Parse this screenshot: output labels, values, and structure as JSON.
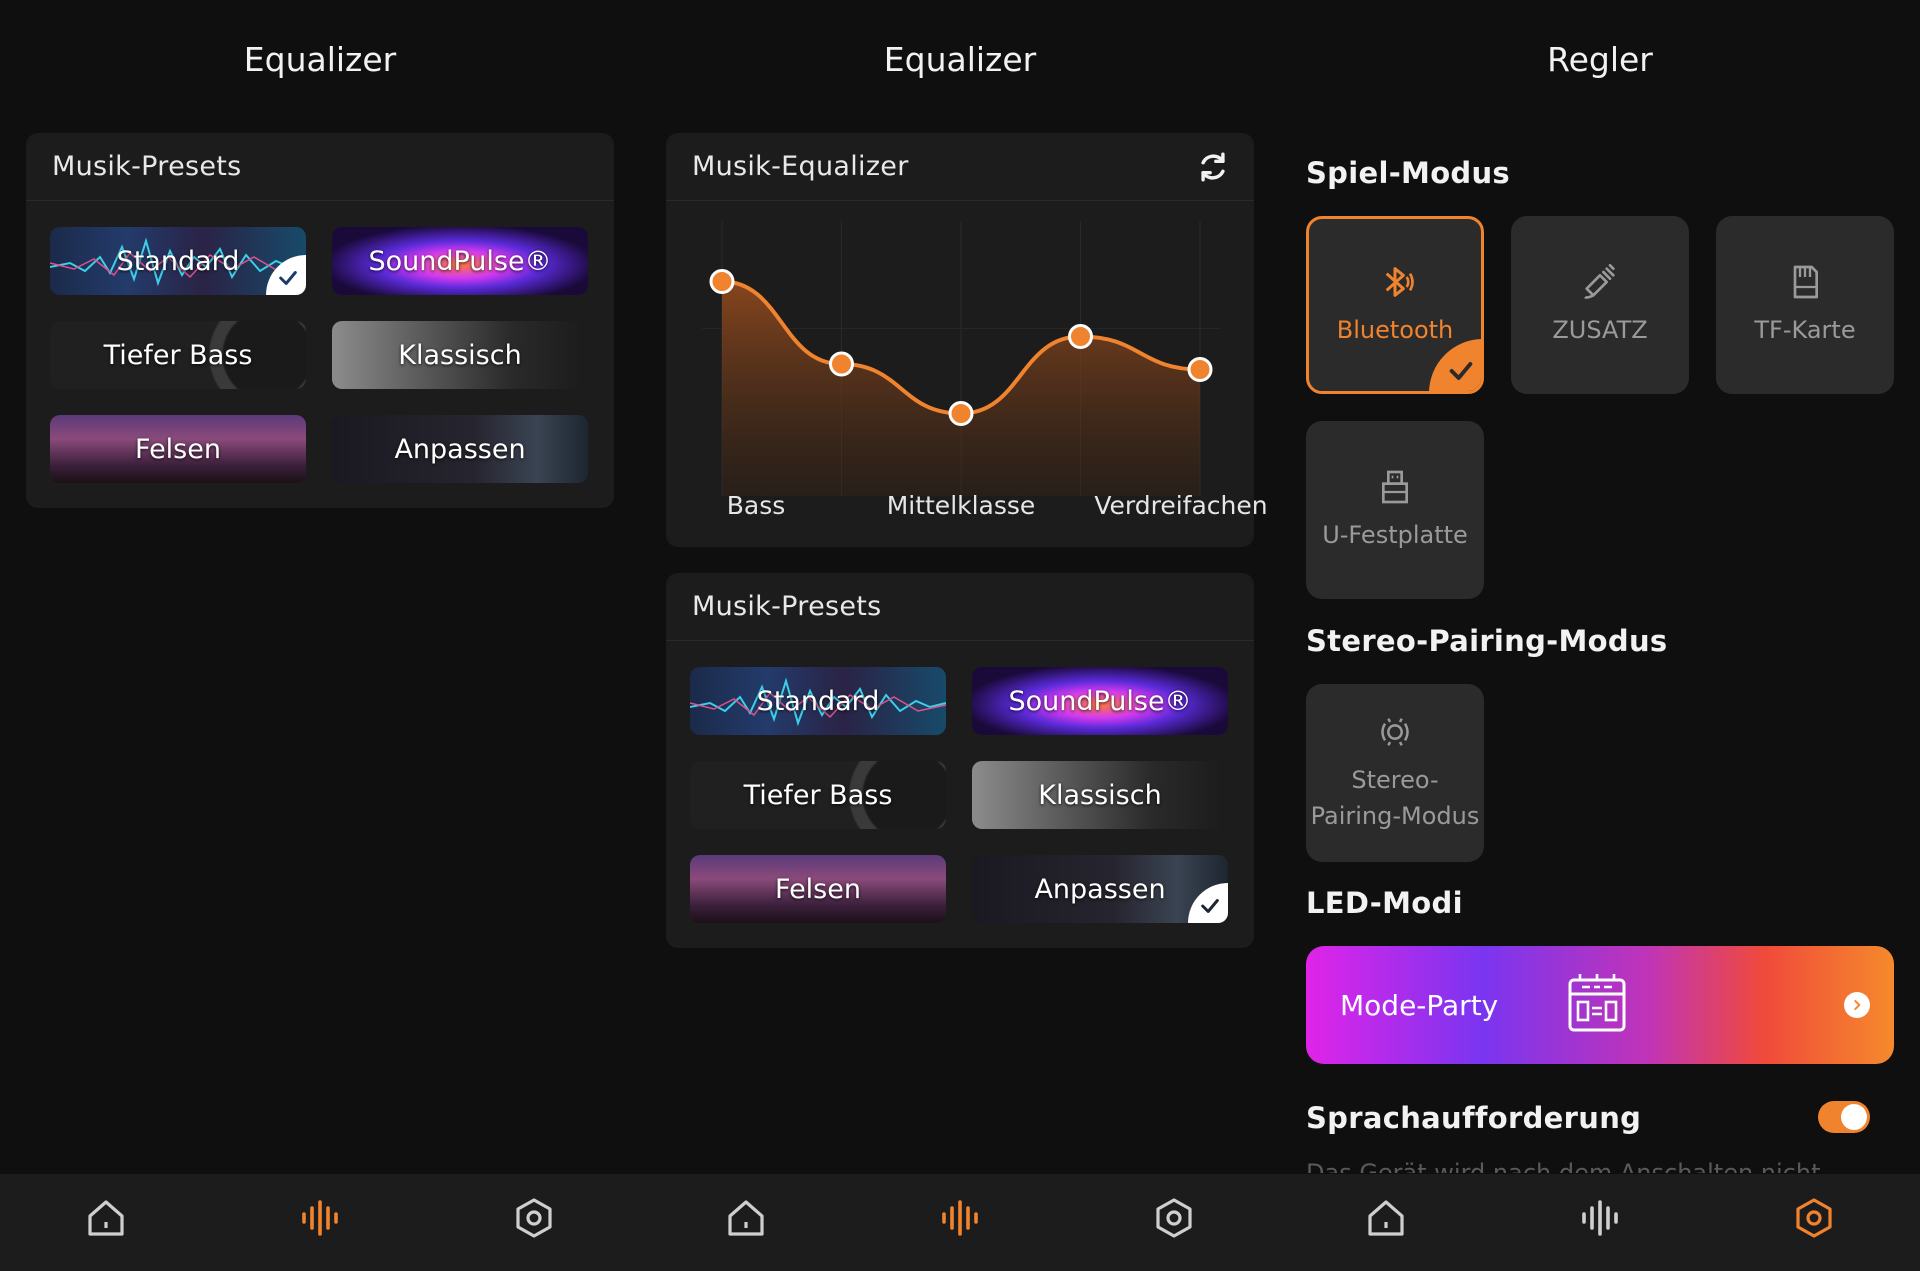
{
  "colors": {
    "accent": "#f0832e",
    "background": "#0f0f0f",
    "card": "#1c1c1c",
    "tile": "#2b2b2b",
    "inactive_text": "#9a9a9a"
  },
  "screen1": {
    "title": "Equalizer",
    "presets_card": {
      "header": "Musik-Presets",
      "presets": [
        {
          "label": "Standard",
          "selected": true
        },
        {
          "label": "SoundPulse®",
          "selected": false
        },
        {
          "label": "Tiefer Bass",
          "selected": false
        },
        {
          "label": "Klassisch",
          "selected": false
        },
        {
          "label": "Felsen",
          "selected": false
        },
        {
          "label": "Anpassen",
          "selected": false
        }
      ]
    }
  },
  "screen2": {
    "title": "Equalizer",
    "eq_card": {
      "header": "Musik-Equalizer",
      "refresh_icon": "refresh-icon",
      "labels": {
        "bass": "Bass",
        "mid": "Mittelklasse",
        "treble": "Verdreifachen"
      }
    },
    "presets_card": {
      "header": "Musik-Presets",
      "presets": [
        {
          "label": "Standard",
          "selected": false
        },
        {
          "label": "SoundPulse®",
          "selected": false
        },
        {
          "label": "Tiefer Bass",
          "selected": false
        },
        {
          "label": "Klassisch",
          "selected": false
        },
        {
          "label": "Felsen",
          "selected": false
        },
        {
          "label": "Anpassen",
          "selected": true
        }
      ]
    }
  },
  "chart_data": {
    "type": "line",
    "x": [
      "Bass",
      "",
      "Mittelklasse",
      "",
      "Verdreifachen"
    ],
    "values": [
      0.78,
      0.48,
      0.3,
      0.58,
      0.46
    ],
    "ylim": [
      0,
      1
    ],
    "grid": true,
    "fill": "area"
  },
  "screen3": {
    "title": "Regler",
    "spiel_modus": {
      "title": "Spiel-Modus",
      "modes": [
        {
          "label": "Bluetooth",
          "icon": "bluetooth-icon",
          "active": true
        },
        {
          "label": "ZUSATZ",
          "icon": "aux-icon",
          "active": false
        },
        {
          "label": "TF-Karte",
          "icon": "sd-card-icon",
          "active": false
        },
        {
          "label": "U-Festplatte",
          "icon": "usb-icon",
          "active": false
        }
      ]
    },
    "stereo": {
      "title": "Stereo-Pairing-Modus",
      "tile_line1": "Stereo-",
      "tile_line2": "Pairing-Modus",
      "icon": "stereo-pairing-icon"
    },
    "led": {
      "title": "LED-Modi",
      "banner_label": "Mode-Party",
      "icon": "party-speaker-icon"
    },
    "voice": {
      "title": "Sprachaufforderung",
      "enabled": true,
      "cutoff_text": "Das Gerät wird nach dem Anschalten nicht"
    }
  },
  "tabbar": {
    "tabs": [
      "home-icon",
      "equalizer-icon",
      "settings-icon"
    ]
  }
}
